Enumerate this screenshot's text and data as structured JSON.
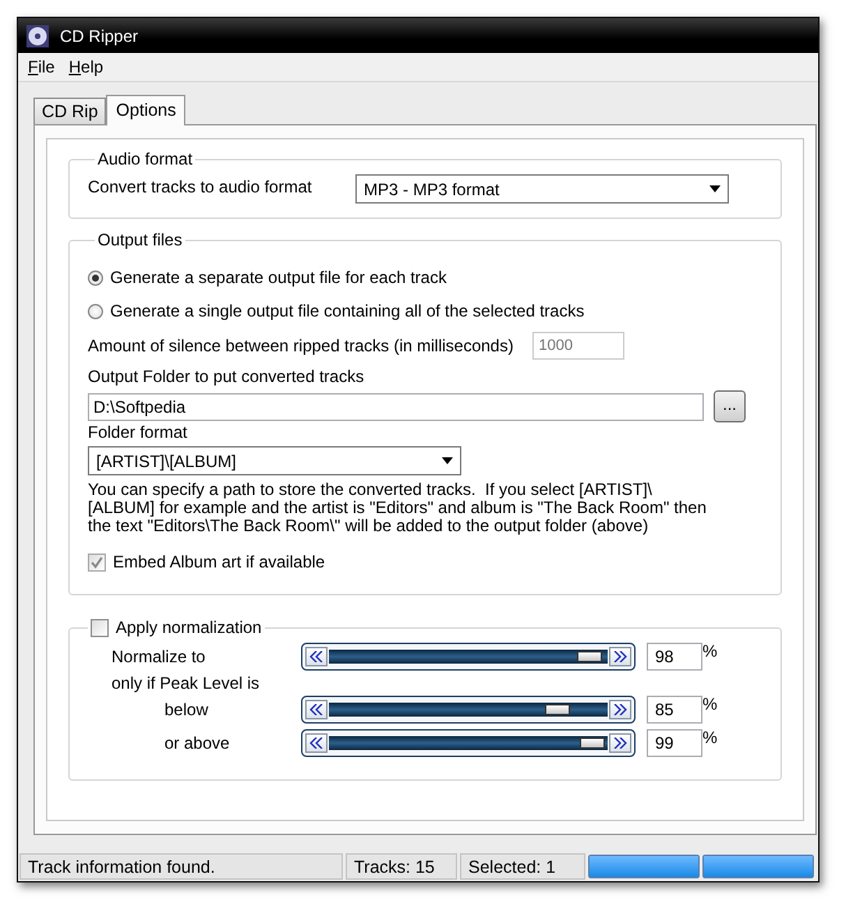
{
  "window": {
    "title": "CD Ripper"
  },
  "menu": [
    {
      "label": "File"
    },
    {
      "label": "Help"
    }
  ],
  "tabs": [
    {
      "label": "CD Rip",
      "selected": false
    },
    {
      "label": "Options",
      "selected": true
    }
  ],
  "audio_format": {
    "title": "Audio format",
    "label": "Convert tracks to audio format",
    "value": "MP3 - MP3 format"
  },
  "output_files": {
    "title": "Output files",
    "modes": [
      {
        "label": "Generate a separate output file for each track",
        "selected": true
      },
      {
        "label": "Generate a single output file containing all of the selected tracks",
        "selected": false
      }
    ],
    "silence": {
      "label": "Amount of silence between ripped tracks (in milliseconds)",
      "value": "1000",
      "disabled": true
    },
    "folder": {
      "label": "Output Folder to put converted tracks",
      "value": "D:\\Softpedia",
      "browse": "..."
    },
    "format": {
      "label": "Folder format",
      "value": "[ARTIST]\\[ALBUM]"
    },
    "help": "You can specify a path to store the converted tracks.  If you select [ARTIST]\\[ALBUM] for example and the artist is \"Editors\" and album is \"The Back Room\" then the text \"Editors\\The Back Room\\\" will be added to the output folder (above)",
    "embed_art": {
      "label": "Embed Album art if available",
      "checked": true,
      "disabled": true
    }
  },
  "normalization": {
    "label": "Apply normalization",
    "checked": false,
    "caption": "only if Peak Level is",
    "sliders": [
      {
        "label": "Normalize to",
        "level": 0.98,
        "value": "98",
        "unit": "%"
      },
      {
        "label": "below",
        "level": 0.85,
        "value": "85",
        "unit": "%"
      },
      {
        "label": "or above",
        "level": 0.99,
        "value": "99",
        "unit": "%"
      }
    ]
  },
  "status_bar": {
    "panels": [
      {
        "text": "Track information found."
      },
      {
        "text": "Tracks: 15"
      },
      {
        "text": "Selected: 1"
      }
    ],
    "progress": [
      {
        "level": 1
      },
      {
        "level": 1
      }
    ]
  }
}
